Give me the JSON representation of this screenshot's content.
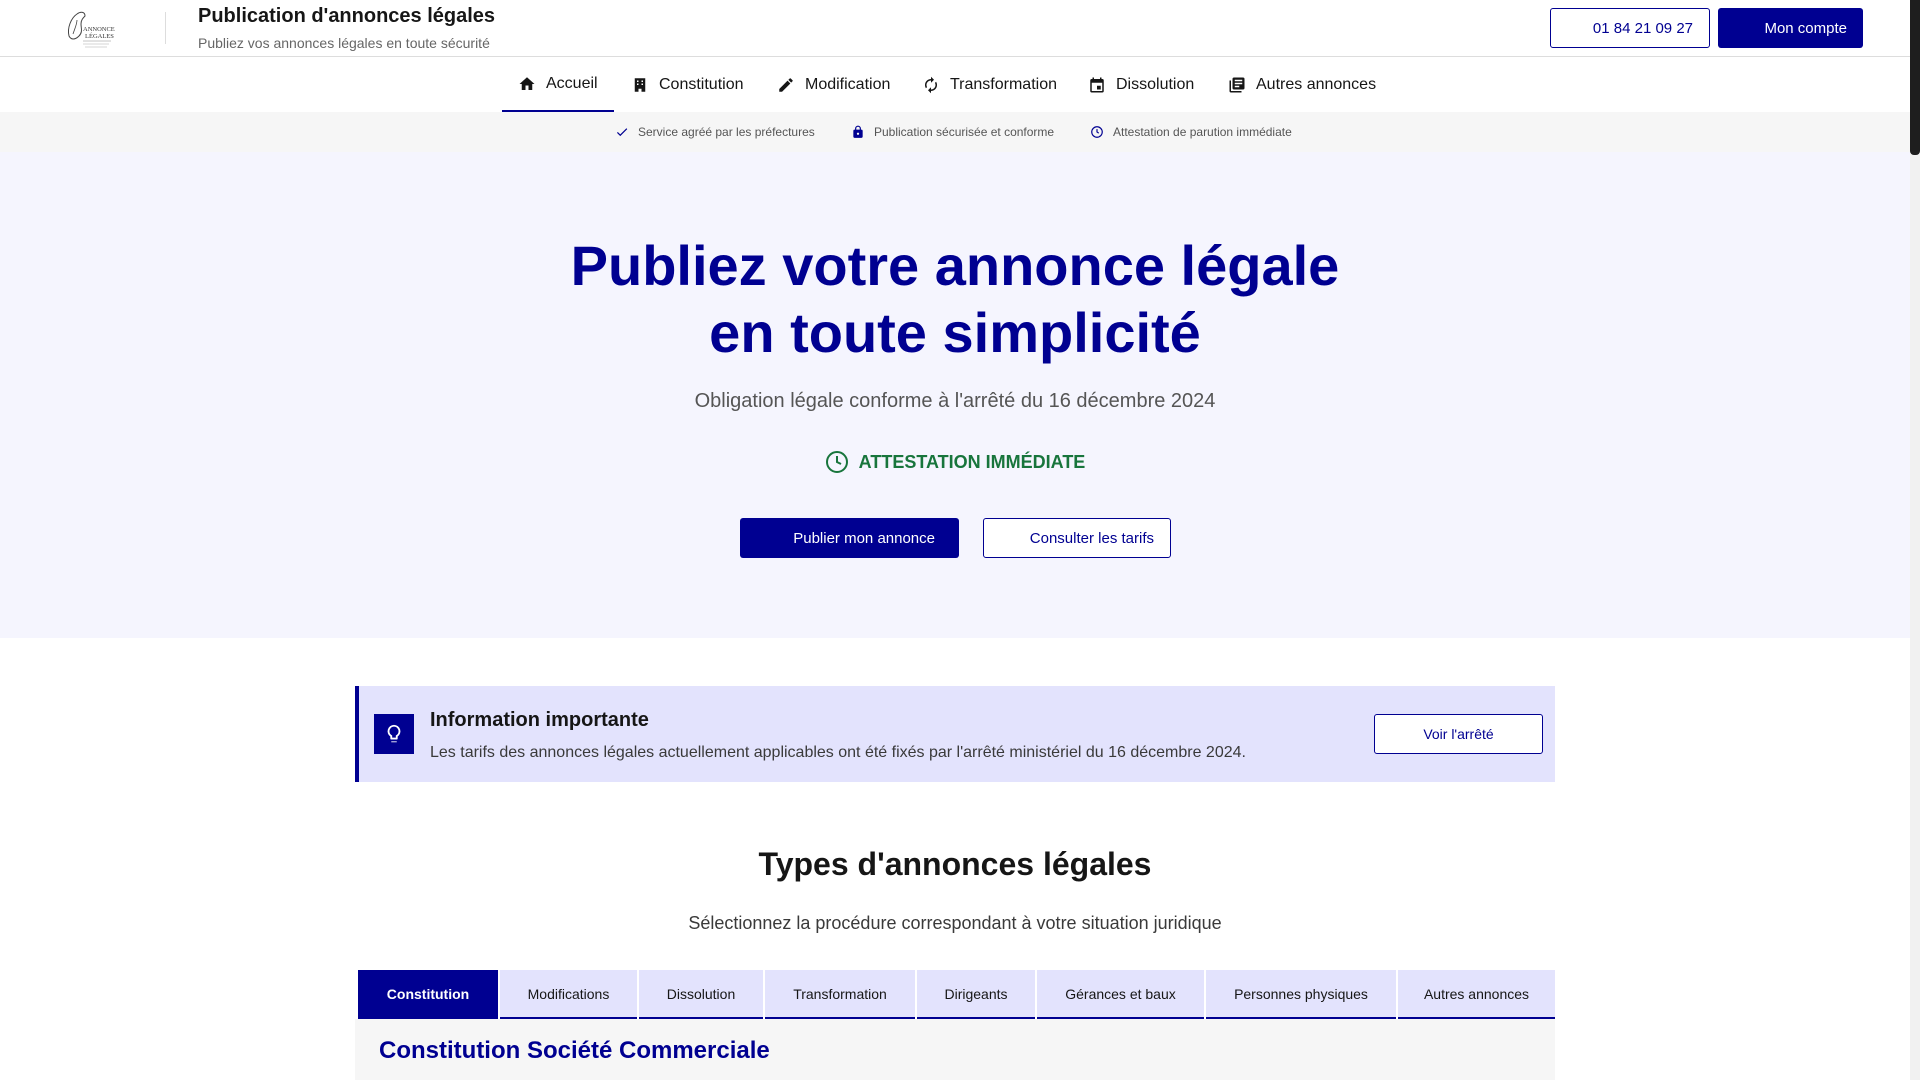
{
  "header": {
    "logo_text": "ANNONCE LÉGALES",
    "title": "Publication d'annonces légales",
    "subtitle": "Publiez vos annonces légales en toute sécurité",
    "phone_label": "01 84 21 09 27",
    "account_label": "Mon compte"
  },
  "nav": {
    "items": [
      {
        "label": "Accueil",
        "icon": "home-icon",
        "active": true
      },
      {
        "label": "Constitution",
        "icon": "building-icon"
      },
      {
        "label": "Modification",
        "icon": "pencil-icon"
      },
      {
        "label": "Transformation",
        "icon": "refresh-icon"
      },
      {
        "label": "Dissolution",
        "icon": "calendar-icon"
      },
      {
        "label": "Autres annonces",
        "icon": "library-icon"
      }
    ]
  },
  "trust": {
    "items": [
      {
        "label": "Service agréé par les préfectures",
        "icon": "check-icon"
      },
      {
        "label": "Publication sécurisée et conforme",
        "icon": "lock-icon"
      },
      {
        "label": "Attestation de parution immédiate",
        "icon": "clock-icon"
      }
    ]
  },
  "hero": {
    "title_line1": "Publiez votre annonce légale",
    "title_line2": "en toute simplicité",
    "subtitle": "Obligation légale conforme à l'arrêté du 16 décembre 2024",
    "attestation": "ATTESTATION IMMÉDIATE",
    "publish_label": "Publier mon annonce",
    "tarifs_label": "Consulter les tarifs"
  },
  "info": {
    "title": "Information importante",
    "text": "Les tarifs des annonces légales actuellement applicables ont été fixés par l'arrêté ministériel du 16 décembre 2024.",
    "button_label": "Voir l'arrêté"
  },
  "section": {
    "title": "Types d'annonces légales",
    "subtitle": "Sélectionnez la procédure correspondant à votre situation juridique",
    "tabs": [
      {
        "label": "Constitution",
        "active": true
      },
      {
        "label": "Modifications"
      },
      {
        "label": "Dissolution"
      },
      {
        "label": "Transformation"
      },
      {
        "label": "Dirigeants"
      },
      {
        "label": "Gérances et baux"
      },
      {
        "label": "Personnes physiques"
      },
      {
        "label": "Autres annonces"
      }
    ],
    "panel_title": "Constitution Société Commerciale"
  },
  "colors": {
    "primary": "#000091",
    "success": "#18753c",
    "hero_bg": "#f5f5fe",
    "info_bg": "#e3e3fd"
  }
}
